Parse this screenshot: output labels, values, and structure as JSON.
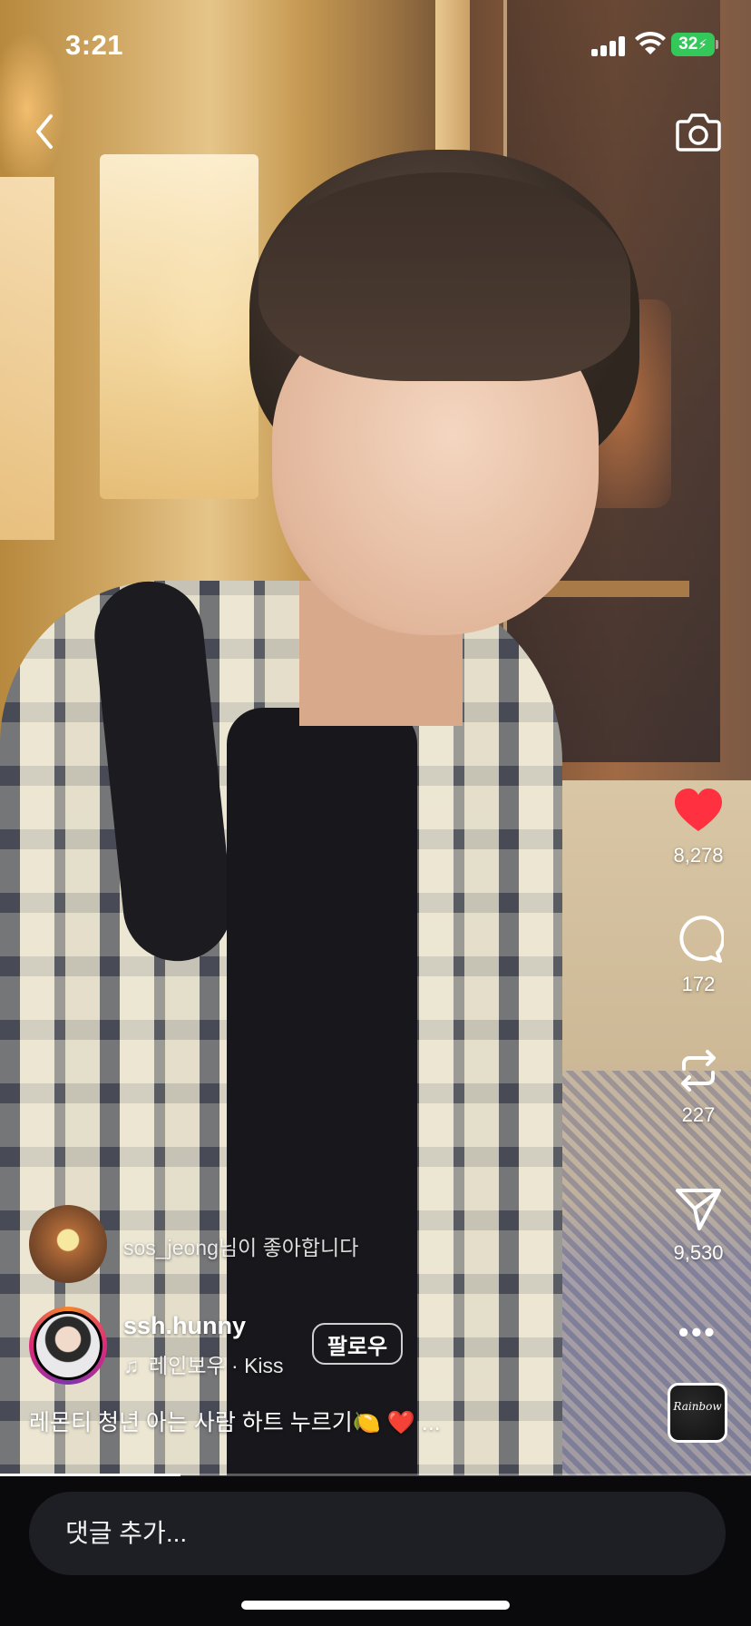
{
  "status_bar": {
    "time": "3:21",
    "battery": "32"
  },
  "header": {
    "back_icon": "chevron-left-icon",
    "camera_icon": "camera-icon"
  },
  "actions": {
    "likes": "8,278",
    "comments": "172",
    "reposts": "227",
    "shares": "9,530",
    "like_color": "#ff3040"
  },
  "liked_by": {
    "username": "sos_jeong",
    "suffix": "님이 좋아합니다"
  },
  "author": {
    "username": "ssh.hunny",
    "follow_label": "팔로우",
    "music": "레인보우 · Kiss"
  },
  "album": {
    "label": "Rainbow"
  },
  "caption": {
    "text": "레몬티 청년 아는 사람 하트 누르기🍋 ❤️ ..."
  },
  "progress": {
    "fraction": 0.24
  },
  "comment_box": {
    "placeholder": "댓글 추가..."
  }
}
